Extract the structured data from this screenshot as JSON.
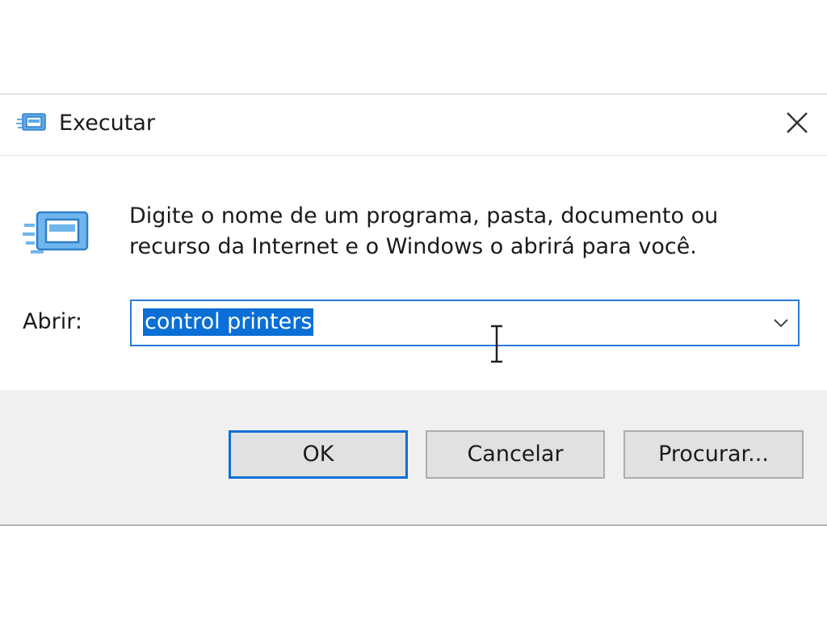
{
  "window": {
    "title": "Executar",
    "title_icon": "run-icon",
    "close_icon": "close-icon"
  },
  "content": {
    "icon": "run-icon",
    "description_line1": "Digite o nome de um programa, pasta, documento ou",
    "description_line2": "recurso da Internet e o Windows o abrirá para você.",
    "open_label": "Abrir:",
    "open_value": "control printers",
    "dropdown_icon": "chevron-down-icon"
  },
  "buttons": {
    "ok_label": "OK",
    "cancel_label": "Cancelar",
    "browse_label": "Procurar..."
  },
  "colors": {
    "accent": "#0a6fd6",
    "footer_bg": "#f0f0f0",
    "button_bg": "#e1e1e1"
  }
}
